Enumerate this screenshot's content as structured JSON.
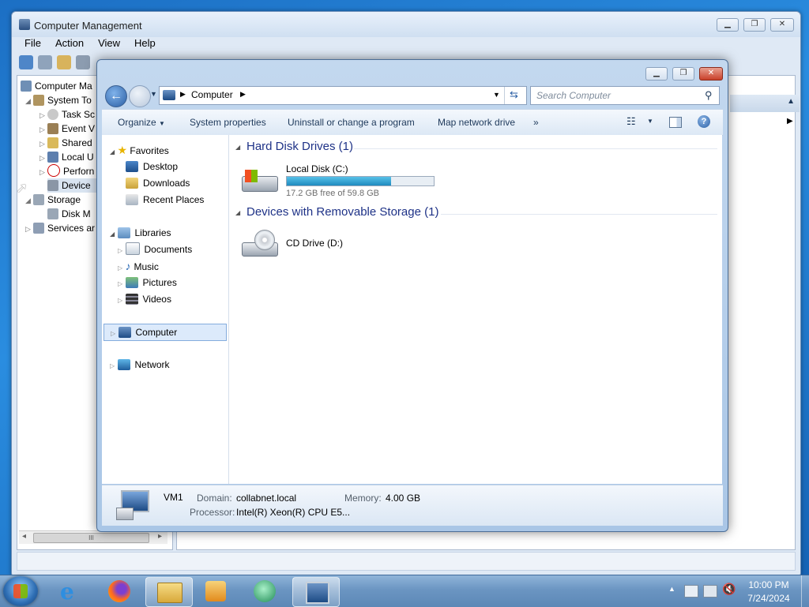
{
  "computer_management": {
    "title": "Computer Management",
    "menu": [
      "File",
      "Action",
      "View",
      "Help"
    ],
    "tree": [
      {
        "label": "Computer Ma",
        "indent": 0
      },
      {
        "label": "System To",
        "indent": 1
      },
      {
        "label": "Task Sc",
        "indent": 2
      },
      {
        "label": "Event V",
        "indent": 2
      },
      {
        "label": "Shared",
        "indent": 2
      },
      {
        "label": "Local U",
        "indent": 2
      },
      {
        "label": "Perforn",
        "indent": 2
      },
      {
        "label": "Device",
        "indent": 2
      },
      {
        "label": "Storage",
        "indent": 1
      },
      {
        "label": "Disk M",
        "indent": 2
      },
      {
        "label": "Services ar",
        "indent": 1
      }
    ],
    "scroll_thumb": "III"
  },
  "explorer": {
    "breadcrumb": "Computer",
    "search_placeholder": "Search Computer",
    "commands": {
      "organize": "Organize",
      "system_properties": "System properties",
      "uninstall": "Uninstall or change a program",
      "map_drive": "Map network drive",
      "more": "»"
    },
    "nav": {
      "favorites": "Favorites",
      "desktop": "Desktop",
      "downloads": "Downloads",
      "recent": "Recent Places",
      "libraries": "Libraries",
      "documents": "Documents",
      "music": "Music",
      "pictures": "Pictures",
      "videos": "Videos",
      "computer": "Computer",
      "network": "Network"
    },
    "groups": {
      "hdd": "Hard Disk Drives (1)",
      "removable": "Devices with Removable Storage (1)"
    },
    "drives": {
      "c_name": "Local Disk (C:)",
      "c_free": "17.2 GB free of 59.8 GB",
      "c_used_fraction": 0.712,
      "d_name": "CD Drive (D:)"
    },
    "details": {
      "name": "VM1",
      "domain_label": "Domain:",
      "domain_value": "collabnet.local",
      "memory_label": "Memory:",
      "memory_value": "4.00 GB",
      "processor_label": "Processor:",
      "processor_value": "Intel(R) Xeon(R) CPU E5..."
    }
  },
  "taskbar": {
    "time": "10:00 PM",
    "date": "7/24/2024"
  },
  "colors": {
    "accent": "#1e3287",
    "selection": "#dceafb",
    "progress": "#1f8bbf"
  }
}
